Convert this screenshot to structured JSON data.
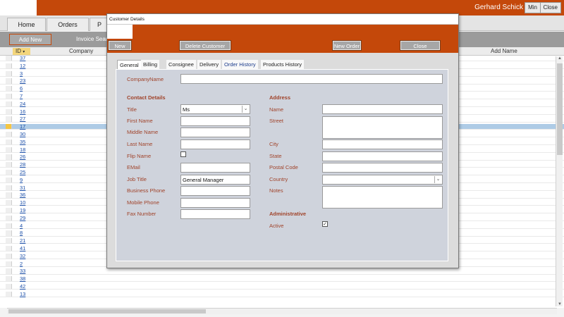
{
  "header": {
    "user_name": "Gerhard Schick",
    "min_label": "Min",
    "close_label": "Close"
  },
  "nav": {
    "tabs": [
      "Home",
      "Orders",
      "P"
    ]
  },
  "toolbar": {
    "add_new_label": "Add New",
    "invoice_search_label": "Invoice Sear"
  },
  "grid": {
    "columns": {
      "id": "ID",
      "company": "Company",
      "add_name": "Add Name"
    },
    "ids": [
      "37",
      "12",
      "3",
      "23",
      "6",
      "7",
      "24",
      "16",
      "27",
      "17",
      "30",
      "35",
      "18",
      "26",
      "28",
      "25",
      "9",
      "31",
      "36",
      "10",
      "19",
      "29",
      "4",
      "8",
      "21",
      "41",
      "32",
      "2",
      "33",
      "38",
      "42",
      "13"
    ],
    "selected_id": "17"
  },
  "modal": {
    "title": "Customer Details",
    "buttons": {
      "new": "New",
      "delete": "Delete Customer",
      "new_order": "New Order",
      "close": "Close"
    },
    "tabs": [
      "General",
      "Billing",
      "Consignee",
      "Delivery",
      "Order History",
      "Products History"
    ],
    "company_name_label": "CompanyName",
    "contact": {
      "section": "Contact Details",
      "title_label": "Title",
      "title_value": "Ms",
      "first_name_label": "First Name",
      "middle_name_label": "Middle Name",
      "last_name_label": "Last Name",
      "flip_name_label": "Flip Name",
      "email_label": "EMail",
      "job_title_label": "Job Title",
      "job_title_value": "General Manager",
      "business_phone_label": "Business Phone",
      "mobile_phone_label": "Mobile Phone",
      "fax_label": "Fax Number"
    },
    "address": {
      "section": "Address",
      "name_label": "Name",
      "street_label": "Street",
      "city_label": "City",
      "state_label": "State",
      "postal_label": "Postal Code",
      "country_label": "Country",
      "notes_label": "Notes"
    },
    "admin": {
      "section": "Administrative",
      "active_label": "Active",
      "active_checked": true
    }
  }
}
